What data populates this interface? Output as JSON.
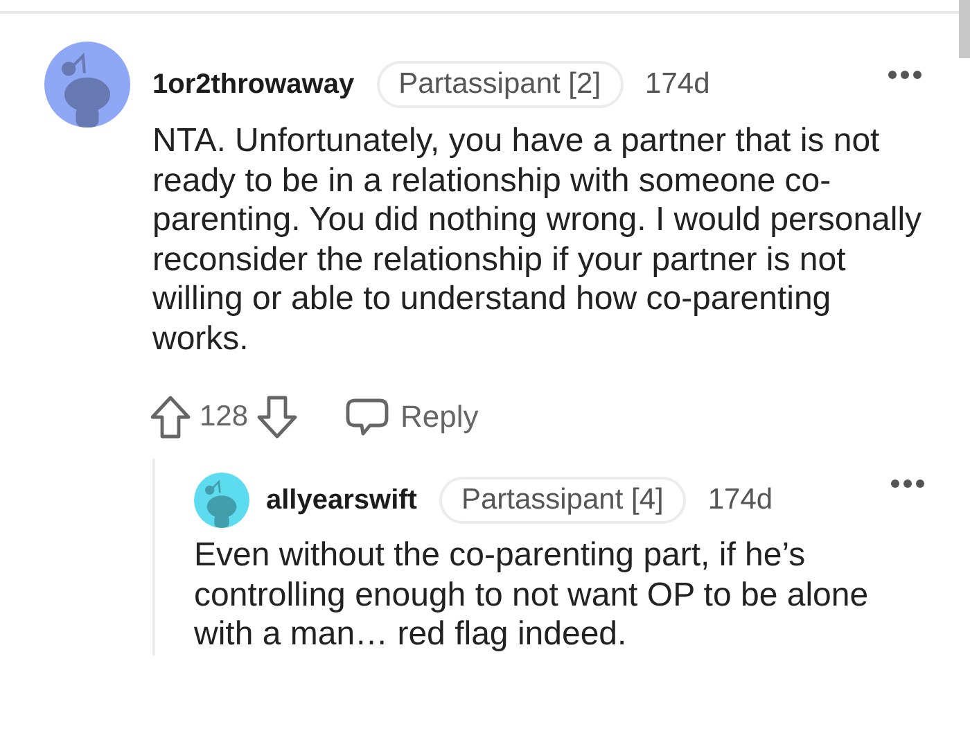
{
  "comments": [
    {
      "username": "1or2throwaway",
      "flair": "Partassipant [2]",
      "age": "174d",
      "color": "#8fa8f6",
      "body": "NTA. Unfortunately, you have a partner that is not ready to be in a relationship with someone co-parenting. You did nothing wrong. I would personally reconsider the relationship if your partner is not willing or able to understand how co-parenting works.",
      "score": "128",
      "reply_label": "Reply",
      "children": [
        {
          "username": "allyearswift",
          "flair": "Partassipant [4]",
          "age": "174d",
          "color": "#5cdcee",
          "body": "Even without the co-parenting part, if he’s controlling enough to not want OP to be alone with a man… red flag indeed."
        }
      ]
    }
  ]
}
